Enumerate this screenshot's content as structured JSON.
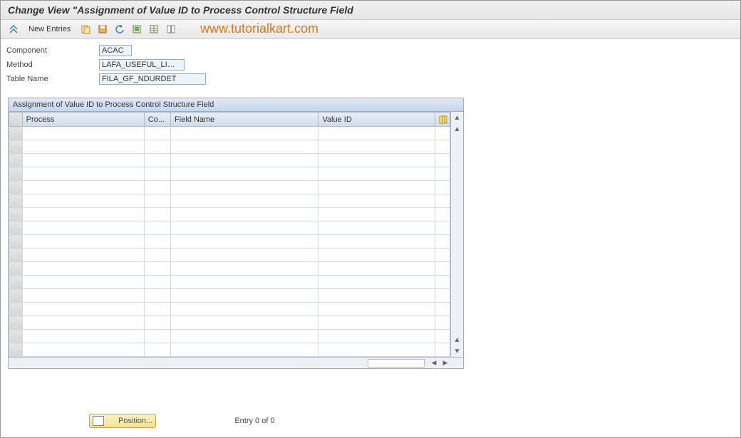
{
  "title": "Change View \"Assignment of Value ID to Process Control Structure Field",
  "toolbar": {
    "new_entries": "New Entries"
  },
  "watermark": "www.tutorialkart.com",
  "form": {
    "component_label": "Component",
    "component_value": "ACAC",
    "method_label": "Method",
    "method_value": "LAFA_USEFUL_LI…",
    "table_label": "Table Name",
    "table_value": "FILA_GF_NDURDET"
  },
  "table": {
    "caption": "Assignment of Value ID to Process Control Structure Field",
    "headers": {
      "process": "Process",
      "co": "Co...",
      "field": "Field Name",
      "valueid": "Value ID"
    }
  },
  "footer": {
    "position": "Position...",
    "entry": "Entry 0 of 0"
  }
}
